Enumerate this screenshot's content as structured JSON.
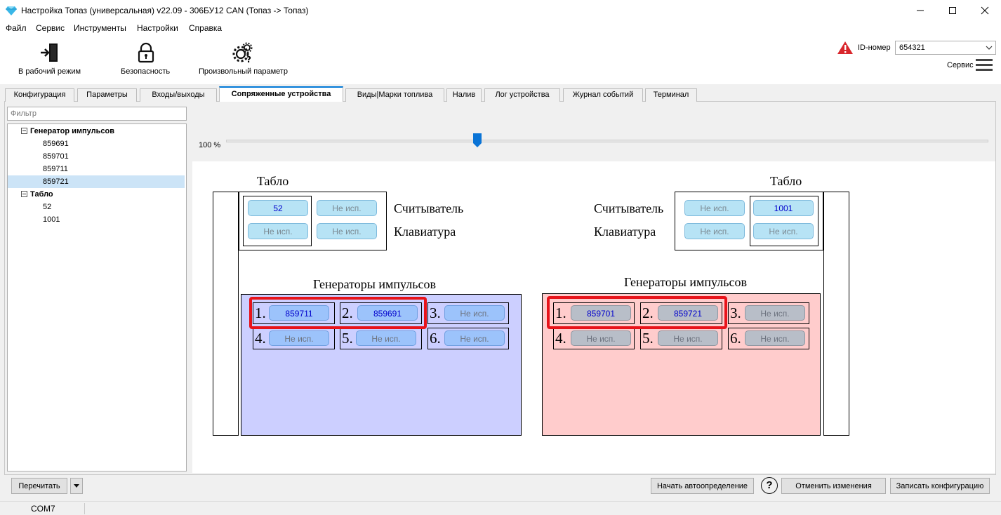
{
  "window": {
    "title": "Настройка Топаз (универсальная) v22.09 - 306БУ12 CAN (Топаз -> Топаз)",
    "icons": {
      "app": "diamond-icon",
      "minimize": "minimize-icon",
      "maximize": "maximize-icon",
      "close": "close-icon"
    }
  },
  "menu": [
    "Файл",
    "Сервис",
    "Инструменты",
    "Настройки",
    "Справка"
  ],
  "toolbar": {
    "work_mode": "В рабочий режим",
    "security": "Безопасность",
    "custom_param": "Произвольный параметр",
    "id_label": "ID-номер",
    "id_value": "654321",
    "service": "Сервис"
  },
  "tabs": [
    "Конфигурация",
    "Параметры",
    "Входы/выходы",
    "Сопряженные устройства",
    "Виды|Марки топлива",
    "Налив",
    "Лог устройства",
    "Журнал событий",
    "Терминал"
  ],
  "active_tab": "Сопряженные устройства",
  "filter": {
    "placeholder": "Фильтр"
  },
  "tree": {
    "group1": "Генератор импульсов",
    "group1_items": [
      "859691",
      "859701",
      "859711",
      "859721"
    ],
    "selected": "859721",
    "group2": "Табло",
    "group2_items": [
      "52",
      "1001"
    ]
  },
  "zoom": {
    "label": "100 %",
    "value_percent": 100,
    "slider_fraction": 0.33
  },
  "diagram": {
    "left": {
      "tablo_title": "Табло",
      "reader_label": "Считыватель",
      "keyboard_label": "Клавиатура",
      "reader_values": [
        "52",
        "Не исп."
      ],
      "keyboard_values": [
        "Не исп.",
        "Не исп."
      ],
      "generators_title": "Генераторы импульсов",
      "slots": [
        {
          "num": "1.",
          "value": "859711"
        },
        {
          "num": "2.",
          "value": "859691"
        },
        {
          "num": "3.",
          "value": "Не исп."
        },
        {
          "num": "4.",
          "value": "Не исп."
        },
        {
          "num": "5.",
          "value": "Не исп."
        },
        {
          "num": "6.",
          "value": "Не исп."
        }
      ]
    },
    "right": {
      "tablo_title": "Табло",
      "reader_label": "Считыватель",
      "keyboard_label": "Клавиатура",
      "reader_values": [
        "Не исп.",
        "1001"
      ],
      "keyboard_values": [
        "Не исп.",
        "Не исп."
      ],
      "generators_title": "Генераторы импульсов",
      "slots": [
        {
          "num": "1.",
          "value": "859701"
        },
        {
          "num": "2.",
          "value": "859721"
        },
        {
          "num": "3.",
          "value": "Не исп."
        },
        {
          "num": "4.",
          "value": "Не исп."
        },
        {
          "num": "5.",
          "value": "Не исп."
        },
        {
          "num": "6.",
          "value": "Не исп."
        }
      ]
    },
    "colors": {
      "left_bg": "#cccfff",
      "right_bg": "#ffcccc",
      "highlight": "#e8131a",
      "used_text": "#0000cc"
    }
  },
  "bottom": {
    "reread": "Перечитать",
    "autodetect": "Начать автоопределение",
    "help": "?",
    "cancel": "Отменить изменения",
    "write": "Записать конфигурацию"
  },
  "status": {
    "port": "COM7"
  }
}
